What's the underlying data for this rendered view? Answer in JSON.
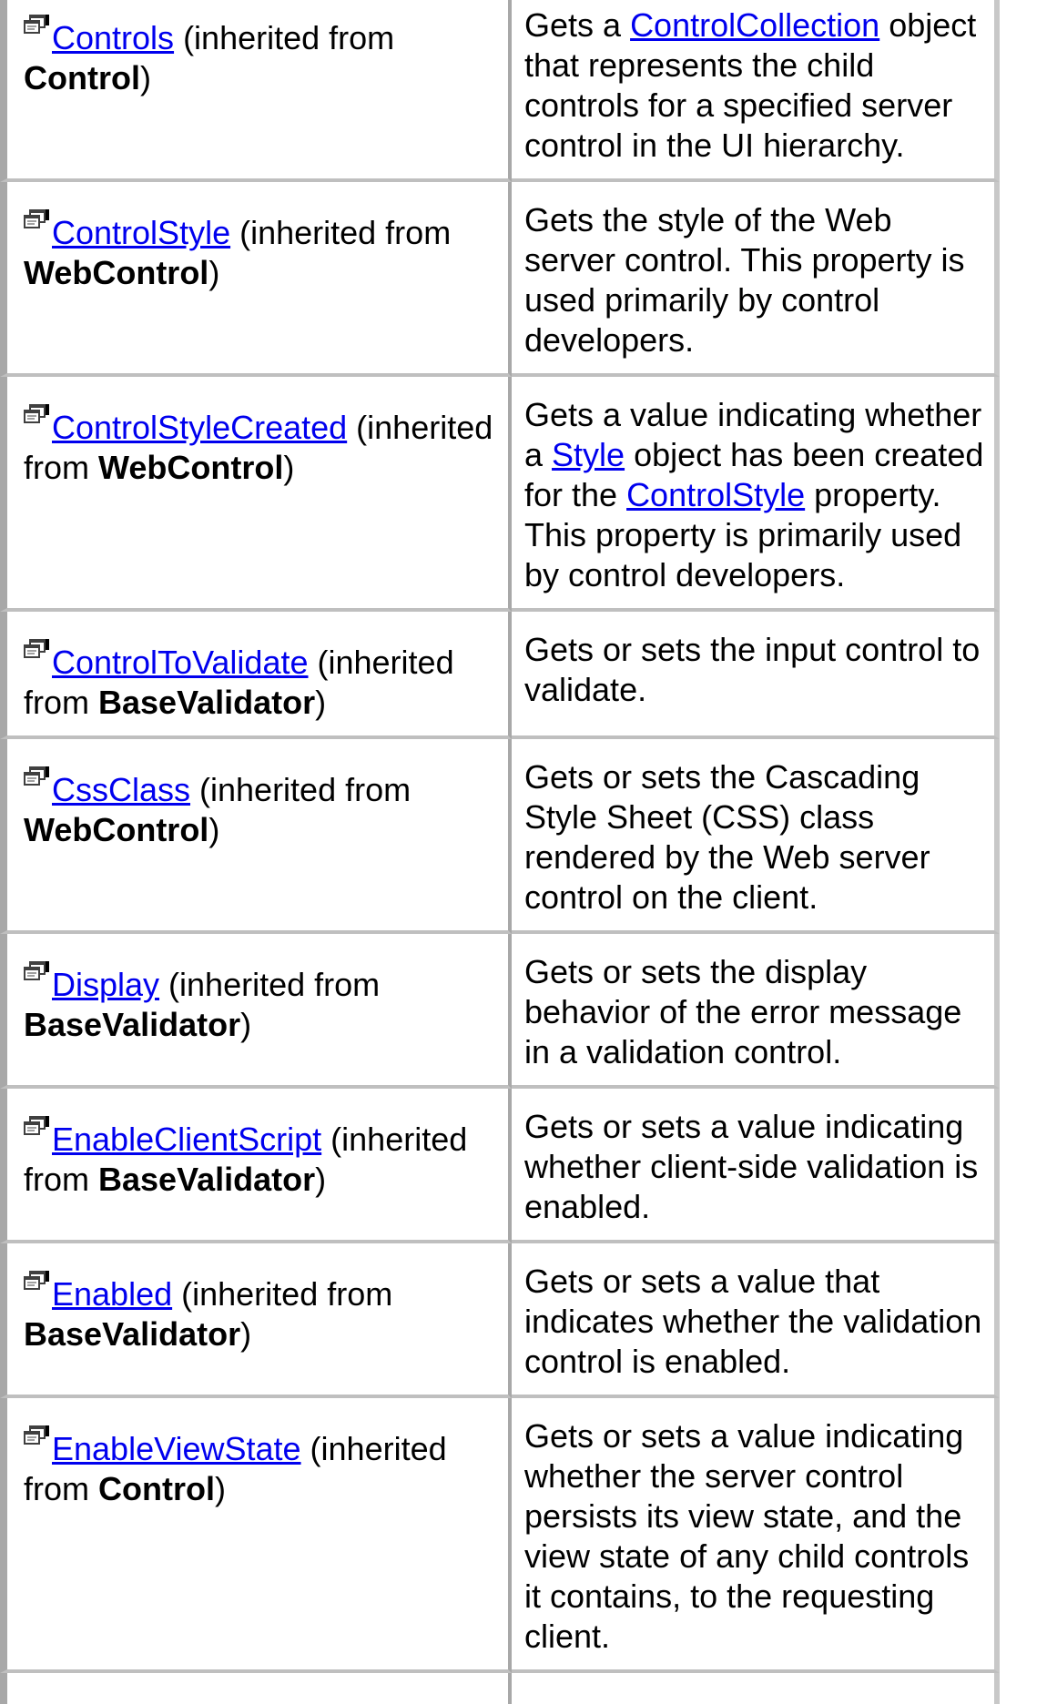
{
  "rows": [
    {
      "icon": "property-icon",
      "name": "Controls",
      "inherited_prefix": " (inherited from ",
      "inherited_class": "Control",
      "inherited_suffix": ")",
      "description": [
        {
          "text": "Gets a "
        },
        {
          "link": "ControlCollection"
        },
        {
          "text": " object that represents the child controls for a specified server control in the UI hierarchy."
        }
      ]
    },
    {
      "icon": "property-icon",
      "name": "ControlStyle",
      "inherited_prefix": " (inherited from ",
      "inherited_class": "WebControl",
      "inherited_suffix": ")",
      "description": [
        {
          "text": "Gets the style of the Web server control. This property is used primarily by control developers."
        }
      ]
    },
    {
      "icon": "property-icon",
      "name": "ControlStyleCreated",
      "inherited_prefix": " (inherited from ",
      "inherited_class": "WebControl",
      "inherited_suffix": ")",
      "description": [
        {
          "text": "Gets a value indicating whether a "
        },
        {
          "link": "Style"
        },
        {
          "text": " object has been created for the "
        },
        {
          "link": "ControlStyle"
        },
        {
          "text": " property. This property is primarily used by control developers."
        }
      ]
    },
    {
      "icon": "property-icon",
      "name": "ControlToValidate",
      "inherited_prefix": " (inherited from ",
      "inherited_class": "BaseValidator",
      "inherited_suffix": ")",
      "description": [
        {
          "text": "Gets or sets the input control to validate."
        }
      ]
    },
    {
      "icon": "property-icon",
      "name": "CssClass",
      "inherited_prefix": " (inherited from ",
      "inherited_class": "WebControl",
      "inherited_suffix": ")",
      "description": [
        {
          "text": "Gets or sets the Cascading Style Sheet (CSS) class rendered by the Web server control on the client."
        }
      ]
    },
    {
      "icon": "property-icon",
      "name": "Display",
      "inherited_prefix": " (inherited from ",
      "inherited_class": "BaseValidator",
      "inherited_suffix": ")",
      "description": [
        {
          "text": "Gets or sets the display behavior of the error message in a validation control."
        }
      ]
    },
    {
      "icon": "property-icon",
      "name": "EnableClientScript",
      "inherited_prefix": " (inherited from ",
      "inherited_class": "BaseValidator",
      "inherited_suffix": ")",
      "description": [
        {
          "text": "Gets or sets a value indicating whether client-side validation is enabled."
        }
      ]
    },
    {
      "icon": "property-icon",
      "name": "Enabled",
      "inherited_prefix": " (inherited from ",
      "inherited_class": "BaseValidator",
      "inherited_suffix": ")",
      "description": [
        {
          "text": "Gets or sets a value that indicates whether the validation control is enabled."
        }
      ]
    },
    {
      "icon": "property-icon",
      "name": "EnableViewState",
      "inherited_prefix": " (inherited from ",
      "inherited_class": "Control",
      "inherited_suffix": ")",
      "description": [
        {
          "text": "Gets or sets a value indicating whether the server control persists its view state, and the view state of any child controls it contains, to the requesting client."
        }
      ]
    },
    {
      "icon": "",
      "name": "",
      "inherited_prefix": "",
      "inherited_class": "",
      "inherited_suffix": "",
      "description": []
    }
  ]
}
